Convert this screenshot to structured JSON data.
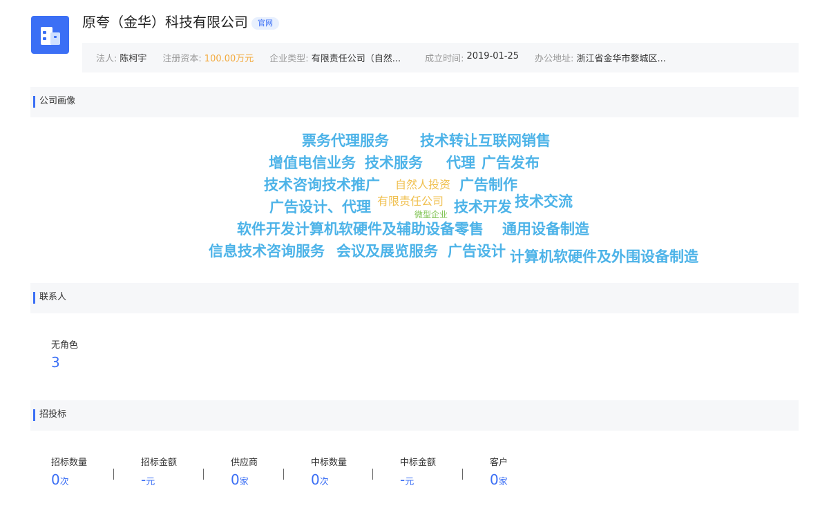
{
  "company": {
    "name": "原夸（金华）科技有限公司",
    "badge": "官网",
    "logo_icon": "building-icon",
    "brand_color": "#3b6ff5"
  },
  "info": {
    "legal_rep_label": "法人:",
    "legal_rep": "陈柯宇",
    "capital_label": "注册资本:",
    "capital": "100.00万元",
    "type_label": "企业类型:",
    "type": "有限责任公司（自然...",
    "founded_label": "成立时间:",
    "founded": "2019-01-25",
    "address_label": "办公地址:",
    "address": "浙江省金华市婺城区..."
  },
  "sections": {
    "portrait": "公司画像",
    "contacts": "联系人",
    "bidding": "招投标"
  },
  "word_cloud": [
    "票务代理服务",
    "技术转让互联网销售",
    "增值电信业务",
    "技术服务",
    "代理",
    "广告发布",
    "技术咨询技术推广",
    "自然人投资",
    "广告制作",
    "广告设计、代理",
    "有限责任公司",
    "微型企业",
    "技术开发",
    "技术交流",
    "软件开发计算机软硬件及辅助设备零售",
    "通用设备制造",
    "信息技术咨询服务",
    "会议及展览服务",
    "广告设计",
    "计算机软硬件及外围设备制造"
  ],
  "contacts": {
    "role_label": "无角色",
    "count": "3"
  },
  "bidding": [
    {
      "label": "招标数量",
      "value": "0",
      "unit": "次"
    },
    {
      "label": "招标金额",
      "value": "-",
      "unit": "元"
    },
    {
      "label": "供应商",
      "value": "0",
      "unit": "家"
    },
    {
      "label": "中标数量",
      "value": "0",
      "unit": "次"
    },
    {
      "label": "中标金额",
      "value": "-",
      "unit": "元"
    },
    {
      "label": "客户",
      "value": "0",
      "unit": "家"
    }
  ]
}
